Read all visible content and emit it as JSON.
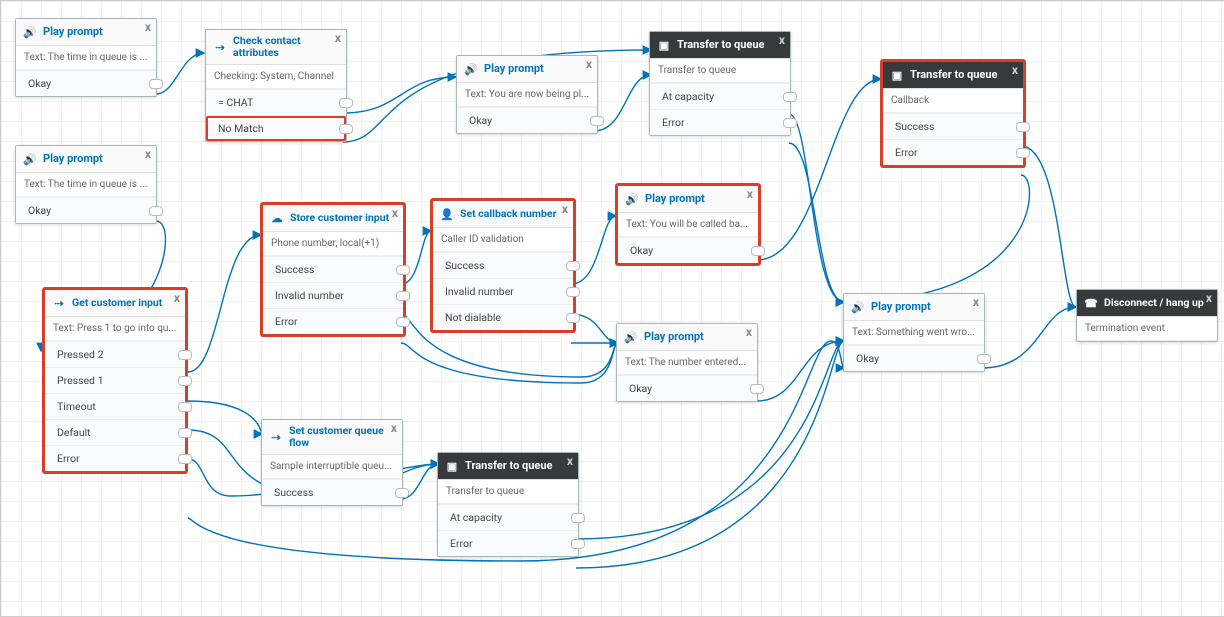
{
  "blocks": {
    "play1": {
      "title": "Play prompt",
      "sub": "Text: The time in queue is ...",
      "branches": [
        "Okay"
      ],
      "dark": false,
      "icon": "speaker"
    },
    "play2": {
      "title": "Play prompt",
      "sub": "Text: The time in queue is ...",
      "branches": [
        "Okay"
      ],
      "dark": false,
      "icon": "speaker"
    },
    "check": {
      "title": "Check contact attributes",
      "sub": "Checking: System, Channel",
      "branches": [
        "= CHAT",
        "No Match"
      ],
      "dark": false,
      "icon": "branch"
    },
    "play3": {
      "title": "Play prompt",
      "sub": "Text: You are now being pl...",
      "branches": [
        "Okay"
      ],
      "dark": false,
      "icon": "speaker"
    },
    "transfer1": {
      "title": "Transfer to queue",
      "sub": "Transfer to queue",
      "branches": [
        "At capacity",
        "Error"
      ],
      "dark": true,
      "icon": "transfer"
    },
    "transfer2": {
      "title": "Transfer to queue",
      "sub": "Callback",
      "branches": [
        "Success",
        "Error"
      ],
      "dark": true,
      "icon": "transfer"
    },
    "getinput": {
      "title": "Get customer input",
      "sub": "Text: Press 1 to go into qu...",
      "branches": [
        "Pressed 2",
        "Pressed 1",
        "Timeout",
        "Default",
        "Error"
      ],
      "dark": false,
      "icon": "branch"
    },
    "store": {
      "title": "Store customer input",
      "sub": "Phone number, local(+1)",
      "branches": [
        "Success",
        "Invalid number",
        "Error"
      ],
      "dark": false,
      "icon": "cloud"
    },
    "callback": {
      "title": "Set callback number",
      "sub": "Caller ID validation",
      "branches": [
        "Success",
        "Invalid number",
        "Not dialable"
      ],
      "dark": false,
      "icon": "person"
    },
    "play4": {
      "title": "Play prompt",
      "sub": "Text: You will be called ba...",
      "branches": [
        "Okay"
      ],
      "dark": false,
      "icon": "speaker"
    },
    "play5": {
      "title": "Play prompt",
      "sub": "Text: The number entered...",
      "branches": [
        "Okay"
      ],
      "dark": false,
      "icon": "speaker"
    },
    "play6": {
      "title": "Play prompt",
      "sub": "Text: Something went wro...",
      "branches": [
        "Okay"
      ],
      "dark": false,
      "icon": "speaker"
    },
    "setqueue": {
      "title": "Set customer queue flow",
      "sub": "Sample interruptible queu...",
      "branches": [
        "Success"
      ],
      "dark": false,
      "icon": "branch"
    },
    "transfer3": {
      "title": "Transfer to queue",
      "sub": "Transfer to queue",
      "branches": [
        "At capacity",
        "Error"
      ],
      "dark": true,
      "icon": "transfer"
    },
    "disconnect": {
      "title": "Disconnect / hang up",
      "sub": "Termination event",
      "branches": [],
      "dark": true,
      "icon": "hangup"
    }
  }
}
